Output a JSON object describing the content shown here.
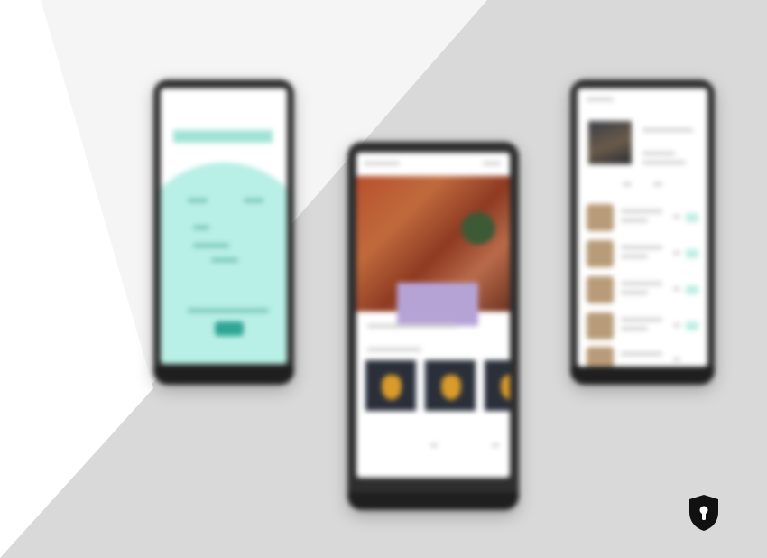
{
  "scene": {
    "description_free": true,
    "background_colors": {
      "gray": "#d9d9d9",
      "light": "#f5f5f5",
      "white": "#ffffff"
    }
  },
  "phones": {
    "left": {
      "title_text": "",
      "accent": "#b8efe6",
      "button_color": "#2fa595"
    },
    "middle": {
      "hero_colors": [
        "#b8502f",
        "#8e3a22",
        "#b6a3d6"
      ],
      "card_count": 3
    },
    "right": {
      "list_item_count": 5,
      "chip_color": "#bfeee5"
    }
  },
  "badge": {
    "icon": "shield-lock-icon",
    "color": "#111111"
  }
}
